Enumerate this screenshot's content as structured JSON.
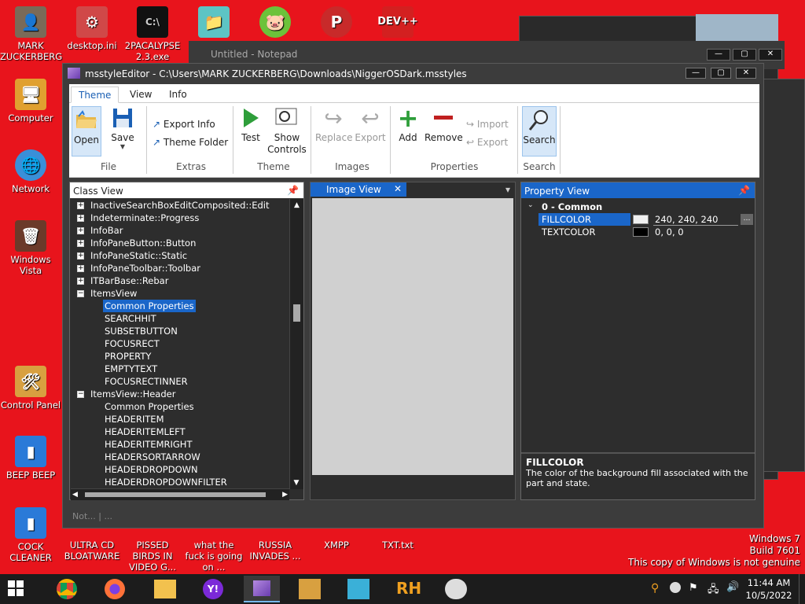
{
  "desktop": {
    "icons_top": [
      {
        "label": "MARK ZUCKERBERG",
        "icon": "user-folder-icon"
      },
      {
        "label": "desktop.ini",
        "icon": "settings-file-icon"
      },
      {
        "label": "2PACALYPSE 2.3.exe",
        "icon": "terminal-icon"
      },
      {
        "label": "",
        "icon": "folder-shortcut-icon"
      },
      {
        "label": "",
        "icon": "angry-birds-icon"
      },
      {
        "label": "",
        "icon": "p-app-icon"
      },
      {
        "label": "",
        "icon": "devcpp-icon"
      }
    ],
    "icons_left": [
      {
        "label": "Computer",
        "icon": "computer-icon"
      },
      {
        "label": "Network",
        "icon": "network-icon"
      },
      {
        "label": "Windows Vista",
        "icon": "recycle-bin-icon"
      },
      {
        "label": "Control Panel",
        "icon": "control-panel-icon"
      },
      {
        "label": "BEEP BEEP",
        "icon": "document-icon"
      },
      {
        "label": "COCK CLEANER",
        "icon": "document-icon"
      }
    ],
    "icons_bottom": [
      {
        "label": "ULTRA CD BLOATWARE",
        "icon": "app-icon"
      },
      {
        "label": "PISSED BIRDS IN VIDEO G...",
        "icon": "app-icon"
      },
      {
        "label": "what the fuck is going on ...",
        "icon": "app-icon"
      },
      {
        "label": "RUSSIA INVADES ...",
        "icon": "app-icon"
      },
      {
        "label": "XMPP",
        "icon": "app-icon"
      },
      {
        "label": "TXT.txt",
        "icon": "text-file-icon"
      }
    ],
    "watermark": {
      "line1": "Windows 7",
      "line2": "Build 7601",
      "line3": "This copy of Windows is not genuine"
    }
  },
  "notepad": {
    "title": "Untitled - Notepad"
  },
  "window": {
    "title": "msstyleEditor - C:\\Users\\MARK ZUCKERBERG\\Downloads\\NiggerOSDark.msstyles",
    "min": "—",
    "max": "▢",
    "close": "✕"
  },
  "ribbon": {
    "tabs": [
      "Theme",
      "View",
      "Info"
    ],
    "open": "Open",
    "save": "Save",
    "export_info": "Export Info",
    "theme_folder": "Theme Folder",
    "test": "Test",
    "show": "Show",
    "controls": "Controls",
    "replace": "Replace",
    "export": "Export",
    "add": "Add",
    "remove": "Remove",
    "import": "Import",
    "export2": "Export",
    "search": "Search",
    "groups": {
      "file": "File",
      "extras": "Extras",
      "theme": "Theme",
      "images": "Images",
      "properties": "Properties",
      "search": "Search"
    }
  },
  "class_view": {
    "title": "Class View",
    "rows": [
      {
        "label": "InactiveSearchBoxEditComposited::Edit",
        "type": "collapsed"
      },
      {
        "label": "Indeterminate::Progress",
        "type": "collapsed"
      },
      {
        "label": "InfoBar",
        "type": "collapsed"
      },
      {
        "label": "InfoPaneButton::Button",
        "type": "collapsed"
      },
      {
        "label": "InfoPaneStatic::Static",
        "type": "collapsed"
      },
      {
        "label": "InfoPaneToolbar::Toolbar",
        "type": "collapsed"
      },
      {
        "label": "ITBarBase::Rebar",
        "type": "collapsed"
      },
      {
        "label": "ItemsView",
        "type": "expanded"
      },
      {
        "label": "Common Properties",
        "type": "child-selected"
      },
      {
        "label": "SEARCHHIT",
        "type": "child"
      },
      {
        "label": "SUBSETBUTTON",
        "type": "child"
      },
      {
        "label": "FOCUSRECT",
        "type": "child"
      },
      {
        "label": "PROPERTY",
        "type": "child"
      },
      {
        "label": "EMPTYTEXT",
        "type": "child"
      },
      {
        "label": "FOCUSRECTINNER",
        "type": "child"
      },
      {
        "label": "ItemsView::Header",
        "type": "expanded"
      },
      {
        "label": "Common Properties",
        "type": "child"
      },
      {
        "label": "HEADERITEM",
        "type": "child"
      },
      {
        "label": "HEADERITEMLEFT",
        "type": "child"
      },
      {
        "label": "HEADERITEMRIGHT",
        "type": "child"
      },
      {
        "label": "HEADERSORTARROW",
        "type": "child"
      },
      {
        "label": "HEADERDROPDOWN",
        "type": "child"
      },
      {
        "label": "HEADERDROPDOWNFILTER",
        "type": "child"
      }
    ]
  },
  "image_view": {
    "title": "Image View",
    "close": "✕",
    "menu": "▾"
  },
  "property_view": {
    "title": "Property View",
    "group": "0 - Common",
    "props": [
      {
        "name": "FILLCOLOR",
        "value": "240, 240, 240",
        "swatch": "#f0f0f0",
        "selected": true
      },
      {
        "name": "TEXTCOLOR",
        "value": "0, 0, 0",
        "swatch": "#000000",
        "selected": false
      }
    ],
    "desc_title": "FILLCOLOR",
    "desc_text": "The color of the background fill associated with the part and state."
  },
  "statusbar": {
    "text": "Not...  |  ..."
  },
  "taskbar": {
    "time": "11:44 AM",
    "date": "10/5/2022"
  }
}
